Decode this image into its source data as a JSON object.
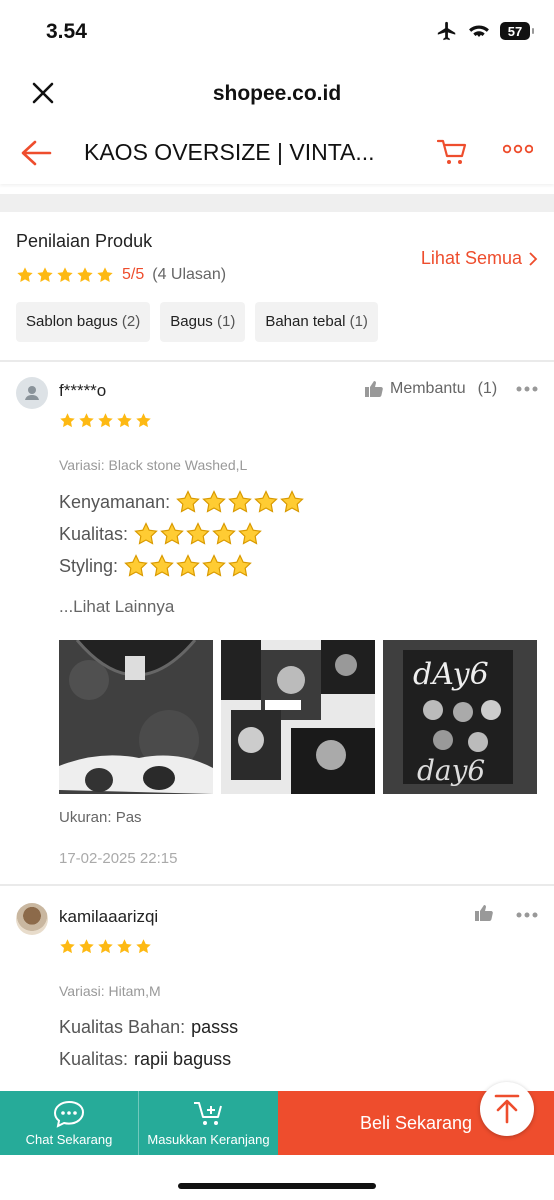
{
  "status_bar": {
    "time": "3.54",
    "battery": "57"
  },
  "browser": {
    "domain": "shopee.co.id"
  },
  "nav": {
    "title": "KAOS OVERSIZE | VINTA..."
  },
  "rating_section": {
    "heading": "Penilaian Produk",
    "score": "5/5",
    "count": "(4 Ulasan)",
    "see_all": "Lihat Semua",
    "chips": [
      {
        "label": "Sablon bagus",
        "count": "(2)"
      },
      {
        "label": "Bagus",
        "count": "(1)"
      },
      {
        "label": "Bahan tebal",
        "count": "(1)"
      }
    ]
  },
  "reviews": [
    {
      "user": "f*****o",
      "stars": 5,
      "helpful": "Membantu",
      "helpful_count": "(1)",
      "variant": "Variasi: Black stone Washed,L",
      "attributes": [
        {
          "label": "Kenyamanan:",
          "emoji_stars": 5
        },
        {
          "label": "Kualitas:",
          "emoji_stars": 5
        },
        {
          "label": "Styling:",
          "emoji_stars": 5
        }
      ],
      "see_more": "...Lihat Lainnya",
      "size": "Ukuran: Pas",
      "date": "17-02-2025 22:15"
    },
    {
      "user": "kamilaaarizqi",
      "stars": 5,
      "variant": "Variasi: Hitam,M",
      "attributes": [
        {
          "label": "Kualitas Bahan:",
          "value": "passs"
        },
        {
          "label": "Kualitas:",
          "value": "rapii baguss"
        }
      ]
    }
  ],
  "bottom_bar": {
    "chat": "Chat Sekarang",
    "add_cart": "Masukkan Keranjang",
    "buy": "Beli Sekarang"
  },
  "colors": {
    "accent": "#ee4d2d",
    "teal": "#26ab99",
    "star": "#fdb913"
  },
  "icons": [
    "close-icon",
    "back-arrow-icon",
    "cart-icon",
    "more-icon",
    "star-icon",
    "thumbs-up-icon",
    "chat-icon",
    "add-cart-icon",
    "arrow-up-icon",
    "airplane-icon",
    "wifi-icon",
    "battery-icon"
  ]
}
